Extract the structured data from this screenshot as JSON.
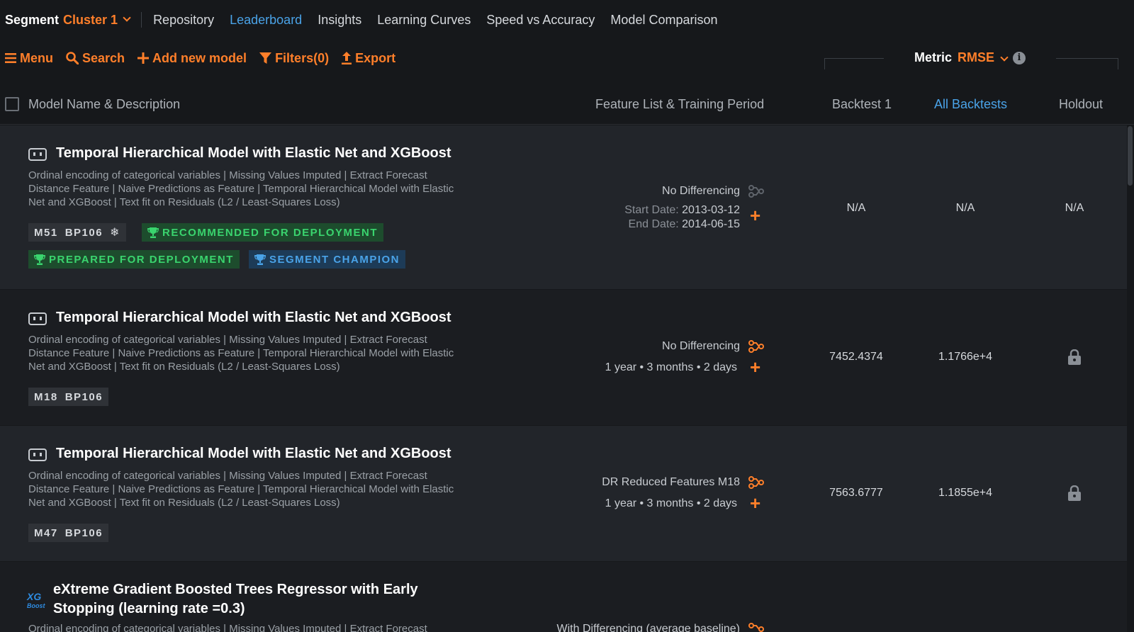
{
  "topnav": {
    "segment_label": "Segment",
    "segment_value": "Cluster 1",
    "tabs": [
      "Repository",
      "Leaderboard",
      "Insights",
      "Learning Curves",
      "Speed vs Accuracy",
      "Model Comparison"
    ],
    "active_tab": "Leaderboard"
  },
  "toolbar": {
    "menu": "Menu",
    "search": "Search",
    "add": "Add new model",
    "filters": "Filters(0)",
    "export": "Export"
  },
  "metric": {
    "label": "Metric",
    "value": "RMSE"
  },
  "header": {
    "name": "Model Name & Description",
    "feature": "Feature List & Training Period",
    "backtest1": "Backtest 1",
    "all_backtests": "All Backtests",
    "holdout": "Holdout"
  },
  "rows": [
    {
      "title": "Temporal Hierarchical Model with Elastic Net and XGBoost",
      "desc": "Ordinal encoding of categorical variables | Missing Values Imputed | Extract Forecast Distance Feature | Naive Predictions as Feature | Temporal Hierarchical Model with Elastic Net and XGBoost | Text fit on Residuals (L2 / Least-Squares Loss)",
      "model_id": "M51",
      "bp": "BP106",
      "badge_recommended": "RECOMMENDED FOR DEPLOYMENT",
      "badge_prepared": "PREPARED FOR DEPLOYMENT",
      "badge_champion": "SEGMENT CHAMPION",
      "feature_list": "No Differencing",
      "start_label": "Start Date:",
      "start_value": "2013-03-12",
      "end_label": "End Date:",
      "end_value": "2014-06-15",
      "backtest1": "N/A",
      "all_backtests": "N/A",
      "holdout": "N/A"
    },
    {
      "title": "Temporal Hierarchical Model with Elastic Net and XGBoost",
      "desc": "Ordinal encoding of categorical variables | Missing Values Imputed | Extract Forecast Distance Feature | Naive Predictions as Feature | Temporal Hierarchical Model with Elastic Net and XGBoost | Text fit on Residuals (L2 / Least-Squares Loss)",
      "model_id": "M18",
      "bp": "BP106",
      "feature_list": "No Differencing",
      "period": "1 year • 3 months • 2 days",
      "backtest1": "7452.4374",
      "all_backtests": "1.1766e+4"
    },
    {
      "title": "Temporal Hierarchical Model with Elastic Net and XGBoost",
      "desc": "Ordinal encoding of categorical variables | Missing Values Imputed | Extract Forecast Distance Feature | Naive Predictions as Feature | Temporal Hierarchical Model with Elastic Net and XGBoost | Text fit on Residuals (L2 / Least-Squares Loss)",
      "model_id": "M47",
      "bp": "BP106",
      "feature_list": "DR Reduced Features M18",
      "period": "1 year • 3 months • 2 days",
      "backtest1": "7563.6777",
      "all_backtests": "1.1855e+4"
    },
    {
      "icon_line1": "XG",
      "icon_line2": "Boost",
      "title_line1": "eXtreme Gradient Boosted Trees Regressor with Early",
      "title_line2": "Stopping (learning rate =0.3)",
      "desc_partial": "Ordinal encoding of categorical variables | Missing Values Imputed | Extract Forecast",
      "feature_partial": "With Differencing (average baseline)"
    }
  ],
  "colors": {
    "accent": "#ff7f2a",
    "link": "#4aa3e8",
    "green": "#3ad46e",
    "background": "#16181b"
  }
}
